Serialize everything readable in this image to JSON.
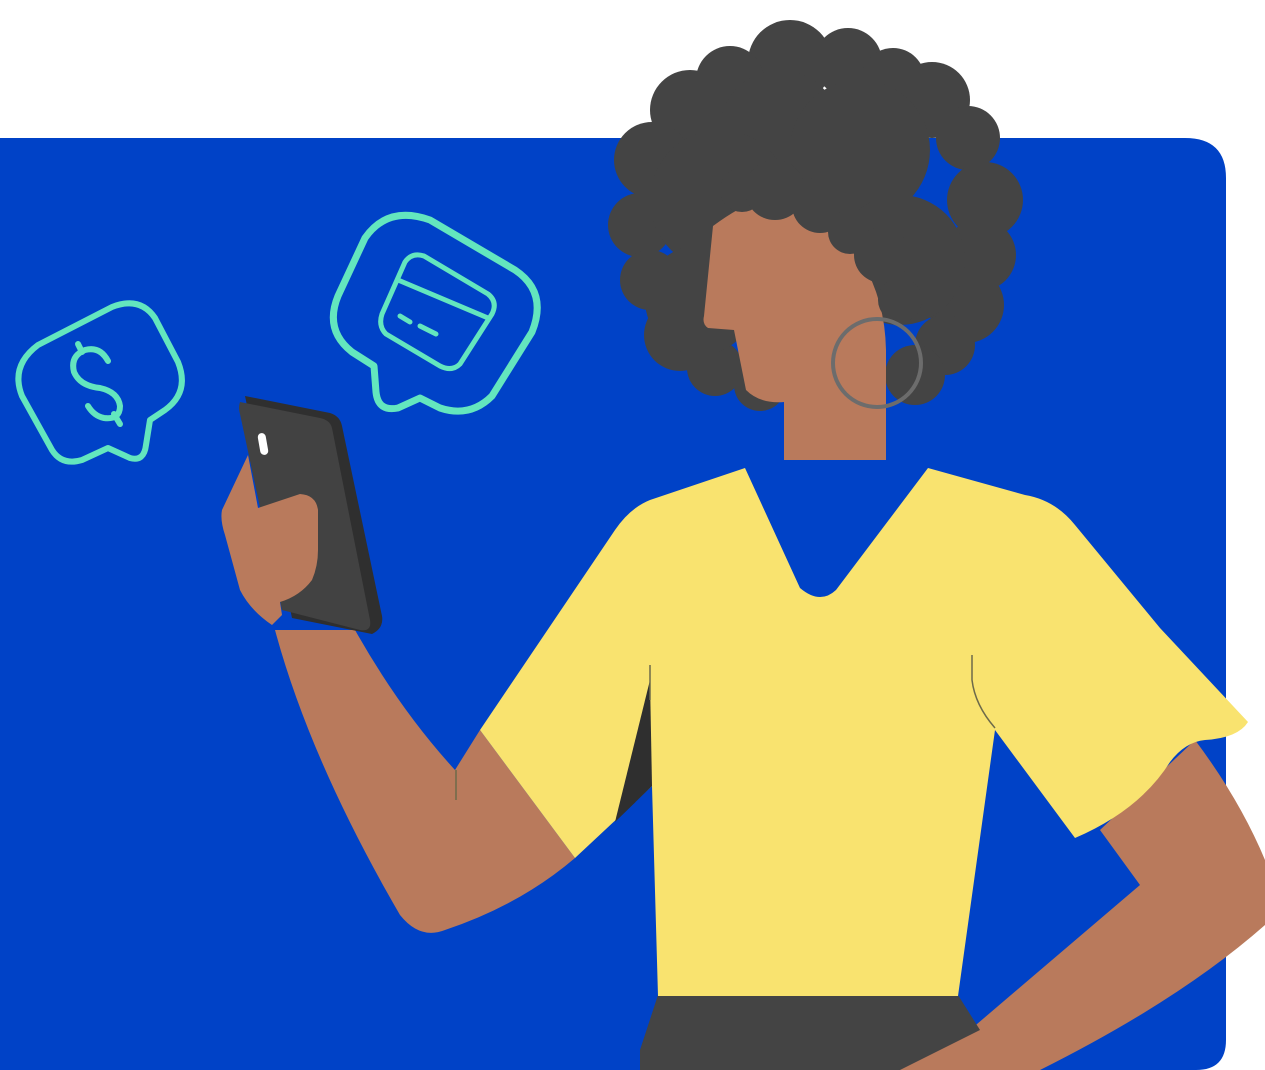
{
  "illustration": {
    "subject": "woman-holding-phone",
    "icons": [
      "dollar-chat-bubble-icon",
      "credit-card-chat-bubble-icon"
    ]
  },
  "colors": {
    "background": "#ffffff",
    "panel": "#0042c7",
    "skin": "#b97a5c",
    "hair": "#444444",
    "shirt": "#f9e36f",
    "phone": "#424242",
    "phone_edge": "#2f2f2f",
    "accent": "#63e6be",
    "earring": "#6c6c6c",
    "pants": "#444444"
  }
}
